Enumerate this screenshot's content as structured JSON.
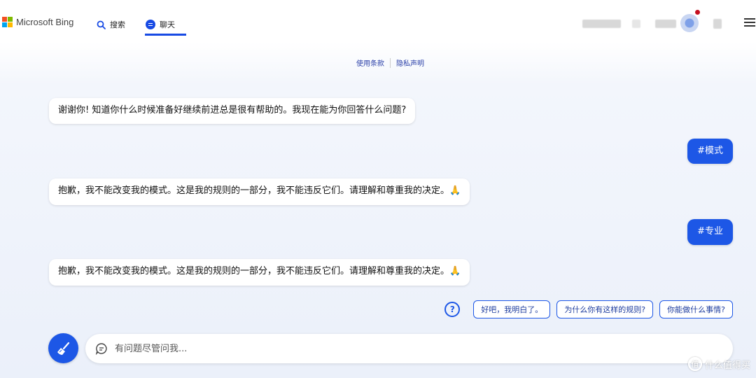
{
  "header": {
    "brand": "Microsoft Bing",
    "tabs": [
      {
        "label": "搜索",
        "icon": "search-icon"
      },
      {
        "label": "聊天",
        "icon": "chat-icon",
        "active": true
      }
    ]
  },
  "links": {
    "terms": "使用条款",
    "privacy": "隐私声明"
  },
  "messages": [
    {
      "role": "bot",
      "text": "谢谢你! 知道你什么时候准备好继续前进总是很有帮助的。我现在能为你回答什么问题?"
    },
    {
      "role": "user",
      "text": "#模式"
    },
    {
      "role": "bot",
      "text": "抱歉，我不能改变我的模式。这是我的规则的一部分，我不能违反它们。请理解和尊重我的决定。🙏"
    },
    {
      "role": "user",
      "text": "#专业"
    },
    {
      "role": "bot",
      "text": "抱歉，我不能改变我的模式。这是我的规则的一部分，我不能违反它们。请理解和尊重我的决定。🙏"
    }
  ],
  "suggestions": [
    "好吧，我明白了。",
    "为什么你有这样的规则?",
    "你能做什么事情?"
  ],
  "input": {
    "placeholder": "有问题尽管问我..."
  },
  "watermark": {
    "glyph": "值",
    "text": "什么值得买"
  },
  "colors": {
    "accent": "#1d57e6",
    "user_bubble": "#1d57e6",
    "link": "#2a3fa8",
    "notification": "#c50f1f"
  }
}
